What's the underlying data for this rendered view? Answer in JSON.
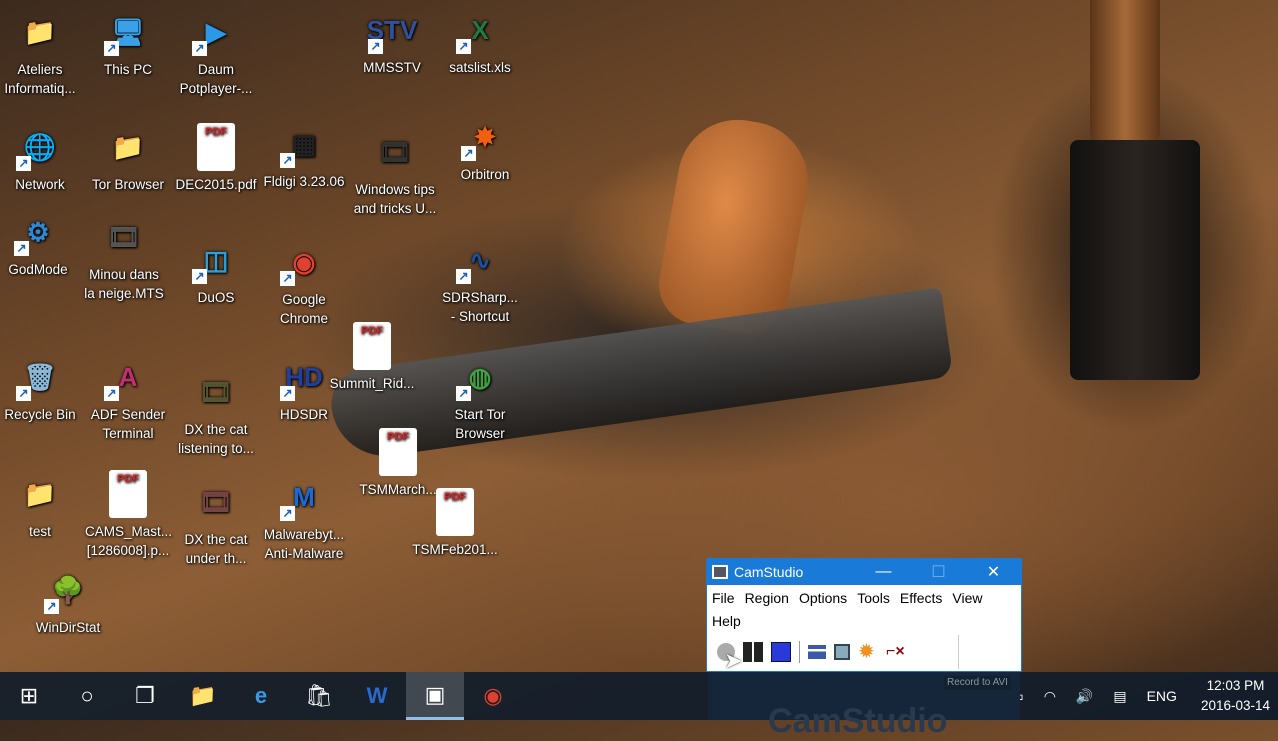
{
  "desktop": {
    "icons": [
      {
        "label": "Ateliers\nInformatiq...",
        "icon": "folder-user-icon",
        "glyph": "📁",
        "color": "#f0c040"
      },
      {
        "label": "This PC",
        "icon": "computer-icon",
        "glyph": "🖥",
        "color": "#3aa0e8"
      },
      {
        "label": "Daum\nPotplayer-...",
        "icon": "play-icon",
        "glyph": "▶",
        "color": "#2a9ae8"
      },
      {
        "label": "MMSSTV",
        "icon": "mmsstv-icon",
        "glyph": "STV",
        "color": "#3050a0"
      },
      {
        "label": "satslist.xls",
        "icon": "excel-icon",
        "glyph": "X",
        "color": "#1e7a40"
      },
      {
        "label": "Network",
        "icon": "network-icon",
        "glyph": "🌐",
        "color": "#2a8ad8"
      },
      {
        "label": "Tor Browser",
        "icon": "folder-icon",
        "glyph": "📁",
        "color": "#d8c070"
      },
      {
        "label": "DEC2015.pdf",
        "icon": "pdf-icon",
        "glyph": "PDF",
        "color": "#e02020"
      },
      {
        "label": "Fldigi 3.23.06",
        "icon": "fldigi-icon",
        "glyph": "▦",
        "color": "#222"
      },
      {
        "label": "Windows tips\nand tricks U...",
        "icon": "video-icon",
        "glyph": "🎞",
        "color": "#333"
      },
      {
        "label": "Orbitron",
        "icon": "orbitron-icon",
        "glyph": "✸",
        "color": "#f06010"
      },
      {
        "label": "GodMode",
        "icon": "control-panel-icon",
        "glyph": "⚙",
        "color": "#2a8ad8"
      },
      {
        "label": "Minou dans\nla neige.MTS",
        "icon": "video-icon",
        "glyph": "🎞",
        "color": "#555"
      },
      {
        "label": "DuOS",
        "icon": "duos-icon",
        "glyph": "◫",
        "color": "#28a0e0"
      },
      {
        "label": "Google\nChrome",
        "icon": "chrome-icon",
        "glyph": "◉",
        "color": "#e04030"
      },
      {
        "label": "SDRSharp...\n- Shortcut",
        "icon": "sdrsharp-icon",
        "glyph": "∿",
        "color": "#1a50a0"
      },
      {
        "label": "Summit_Rid...",
        "icon": "pdf-icon",
        "glyph": "PDF",
        "color": "#e02020"
      },
      {
        "label": "Recycle Bin",
        "icon": "recycle-bin-icon",
        "glyph": "🗑",
        "color": "#8ab8d8"
      },
      {
        "label": "ADF Sender\nTerminal",
        "icon": "adf-icon",
        "glyph": "A",
        "color": "#c03070"
      },
      {
        "label": "DX the cat\nlistening to...",
        "icon": "video-icon",
        "glyph": "🎞",
        "color": "#553"
      },
      {
        "label": "HDSDR",
        "icon": "hdsdr-icon",
        "glyph": "HD",
        "color": "#2040a0"
      },
      {
        "label": "Start Tor\nBrowser",
        "icon": "tor-icon",
        "glyph": "◍",
        "color": "#40a040"
      },
      {
        "label": "TSMMarch...",
        "icon": "pdf-icon",
        "glyph": "PDF",
        "color": "#e02020"
      },
      {
        "label": "test",
        "icon": "folder-icon",
        "glyph": "📁",
        "color": "#f0c040"
      },
      {
        "label": "CAMS_Mast...\n[1286008].p...",
        "icon": "pdf-icon",
        "glyph": "PDF",
        "color": "#e02020"
      },
      {
        "label": "DX the cat\nunder th...",
        "icon": "video-icon",
        "glyph": "🎞",
        "color": "#744"
      },
      {
        "label": "Malwarebyt...\nAnti-Malware",
        "icon": "malwarebytes-icon",
        "glyph": "M",
        "color": "#1a6ad8"
      },
      {
        "label": "TSMFeb201...",
        "icon": "pdf-icon",
        "glyph": "PDF",
        "color": "#e02020"
      },
      {
        "label": "WinDirStat",
        "icon": "windirstat-icon",
        "glyph": "🌳",
        "color": "#3a8a30"
      }
    ]
  },
  "camstudio": {
    "title": "CamStudio",
    "menu": [
      "File",
      "Region",
      "Options",
      "Tools",
      "Effects",
      "View",
      "Help"
    ],
    "tooltip": "Record to AVI",
    "preview_title": "CamStudio"
  },
  "taskbar": {
    "apps": [
      "start",
      "search",
      "task-view",
      "file-explorer",
      "edge",
      "store",
      "word",
      "camstudio",
      "chrome"
    ],
    "language": "ENG",
    "time": "12:03 PM",
    "date": "2016-03-14"
  }
}
